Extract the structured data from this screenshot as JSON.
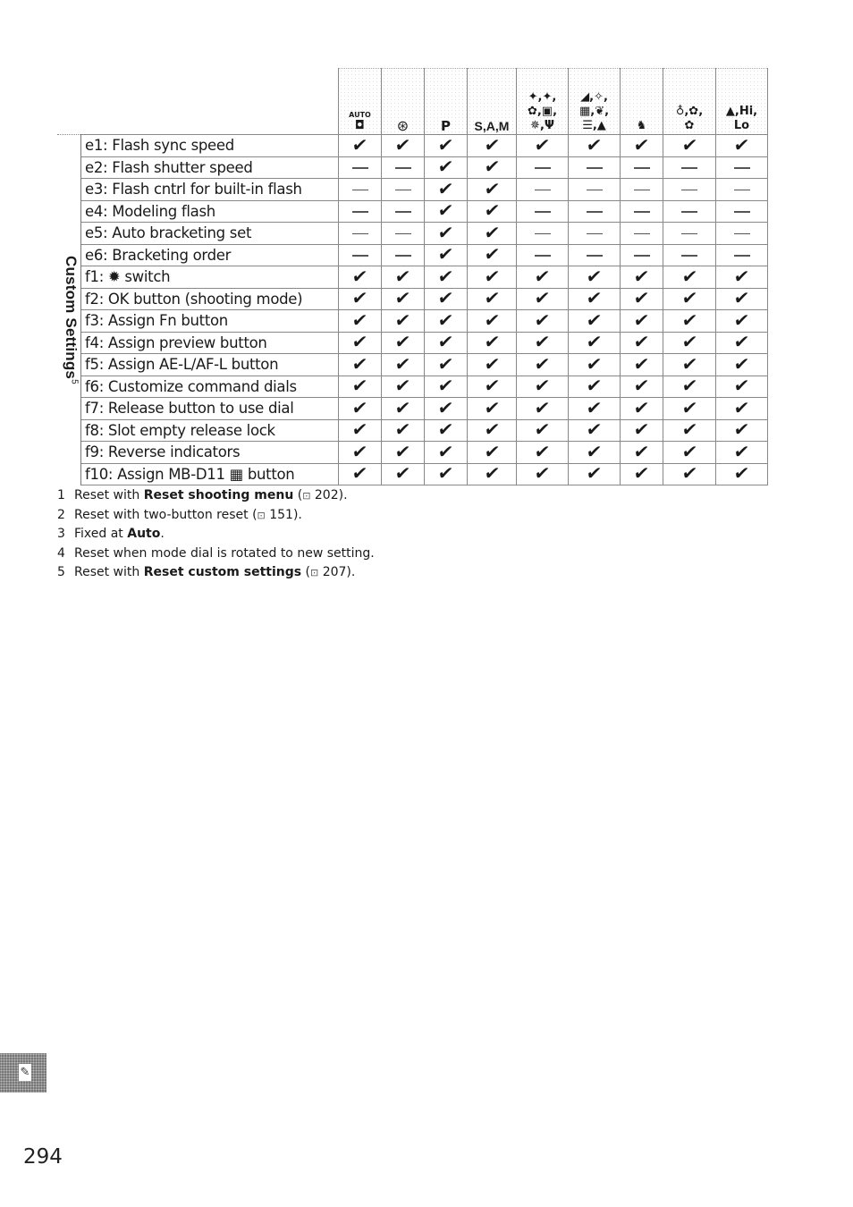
{
  "side_label": "Custom Settings",
  "side_label_note": "5",
  "columns": [
    {
      "id": "auto",
      "label": "AUTO",
      "icon": "auto-mode-icon"
    },
    {
      "id": "flash-off",
      "label": "⊛",
      "icon": "flash-off-icon"
    },
    {
      "id": "p",
      "label": "P",
      "icon": "program-mode-icon"
    },
    {
      "id": "sam",
      "label": "S, A, M",
      "icon": "sam-mode-icon"
    },
    {
      "id": "scene1",
      "label": "portrait, landscape, child, sports, close-up, night portrait, party, food",
      "icon": "scene-group-1-icon"
    },
    {
      "id": "scene2",
      "label": "night landscape, beach/snow, sunset, dusk/dawn, autumn colors, blossom",
      "icon": "scene-group-2-icon"
    },
    {
      "id": "pet",
      "label": "pet portrait",
      "icon": "pet-portrait-icon"
    },
    {
      "id": "scene3",
      "label": "candlelight, blossom, autumn colors",
      "icon": "scene-group-3-icon"
    },
    {
      "id": "scene4",
      "label": "high key, low key",
      "icon": "scene-group-4-icon"
    }
  ],
  "header_symbols": {
    "auto": [
      "AUTO",
      "◘"
    ],
    "flash_off": "⊛",
    "p": "P",
    "sam": "S,A,M",
    "scene1": [
      "✦,✦,",
      "✿,▣,",
      "✵,Ψ"
    ],
    "scene2": [
      "◢,✧,",
      "▦,❦,",
      "☰,▲"
    ],
    "pet": "♞",
    "scene3": [
      "♁,✿,",
      "✿"
    ],
    "scene4": [
      "▲,Hi,",
      "Lo"
    ]
  },
  "rows": [
    {
      "label": "e1: Flash sync speed",
      "values": [
        "check",
        "check",
        "check",
        "check",
        "check",
        "check",
        "check",
        "check",
        "check"
      ]
    },
    {
      "label": "e2: Flash shutter speed",
      "values": [
        "dash",
        "dash",
        "check",
        "check",
        "dash",
        "dash",
        "dash",
        "dash",
        "dash"
      ]
    },
    {
      "label": "e3: Flash cntrl for built-in flash",
      "values": [
        "dash",
        "dash",
        "check",
        "check",
        "dash",
        "dash",
        "dash",
        "dash",
        "dash"
      ]
    },
    {
      "label": "e4: Modeling flash",
      "values": [
        "dash",
        "dash",
        "check",
        "check",
        "dash",
        "dash",
        "dash",
        "dash",
        "dash"
      ]
    },
    {
      "label": "e5: Auto bracketing set",
      "values": [
        "dash",
        "dash",
        "check",
        "check",
        "dash",
        "dash",
        "dash",
        "dash",
        "dash"
      ]
    },
    {
      "label": "e6: Bracketing order",
      "values": [
        "dash",
        "dash",
        "check",
        "check",
        "dash",
        "dash",
        "dash",
        "dash",
        "dash"
      ]
    },
    {
      "label": "f1: ✹ switch",
      "values": [
        "check",
        "check",
        "check",
        "check",
        "check",
        "check",
        "check",
        "check",
        "check"
      ]
    },
    {
      "label": "f2: OK button (shooting mode)",
      "values": [
        "check",
        "check",
        "check",
        "check",
        "check",
        "check",
        "check",
        "check",
        "check"
      ]
    },
    {
      "label": "f3: Assign Fn button",
      "values": [
        "check",
        "check",
        "check",
        "check",
        "check",
        "check",
        "check",
        "check",
        "check"
      ]
    },
    {
      "label": "f4: Assign preview button",
      "values": [
        "check",
        "check",
        "check",
        "check",
        "check",
        "check",
        "check",
        "check",
        "check"
      ]
    },
    {
      "label": "f5: Assign AE-L/AF-L button",
      "values": [
        "check",
        "check",
        "check",
        "check",
        "check",
        "check",
        "check",
        "check",
        "check"
      ]
    },
    {
      "label": "f6: Customize command dials",
      "values": [
        "check",
        "check",
        "check",
        "check",
        "check",
        "check",
        "check",
        "check",
        "check"
      ]
    },
    {
      "label": "f7: Release button to use dial",
      "values": [
        "check",
        "check",
        "check",
        "check",
        "check",
        "check",
        "check",
        "check",
        "check"
      ]
    },
    {
      "label": "f8: Slot empty release lock",
      "values": [
        "check",
        "check",
        "check",
        "check",
        "check",
        "check",
        "check",
        "check",
        "check"
      ]
    },
    {
      "label": "f9: Reverse indicators",
      "values": [
        "check",
        "check",
        "check",
        "check",
        "check",
        "check",
        "check",
        "check",
        "check"
      ]
    },
    {
      "label": "f10: Assign MB-D11 ▦ button",
      "values": [
        "check",
        "check",
        "check",
        "check",
        "check",
        "check",
        "check",
        "check",
        "check"
      ]
    }
  ],
  "symbols": {
    "check": "✔",
    "dash": ""
  },
  "footnotes": [
    {
      "num": "1",
      "pre": "Reset with ",
      "bold": "Reset shooting menu",
      "post": " (",
      "ref": "202",
      "end": ")."
    },
    {
      "num": "2",
      "pre": "Reset with two-button reset (",
      "bold": "",
      "post": "",
      "ref": "151",
      "end": ")."
    },
    {
      "num": "3",
      "pre": "Fixed at ",
      "bold": "Auto",
      "post": ".",
      "ref": "",
      "end": ""
    },
    {
      "num": "4",
      "pre": "Reset when mode dial is rotated to new setting.",
      "bold": "",
      "post": "",
      "ref": "",
      "end": ""
    },
    {
      "num": "5",
      "pre": "Reset with ",
      "bold": "Reset custom settings",
      "post": " (",
      "ref": "207",
      "end": ")."
    }
  ],
  "book_icon": "⊡",
  "section_tab_icon": "✎",
  "page_number": "294"
}
